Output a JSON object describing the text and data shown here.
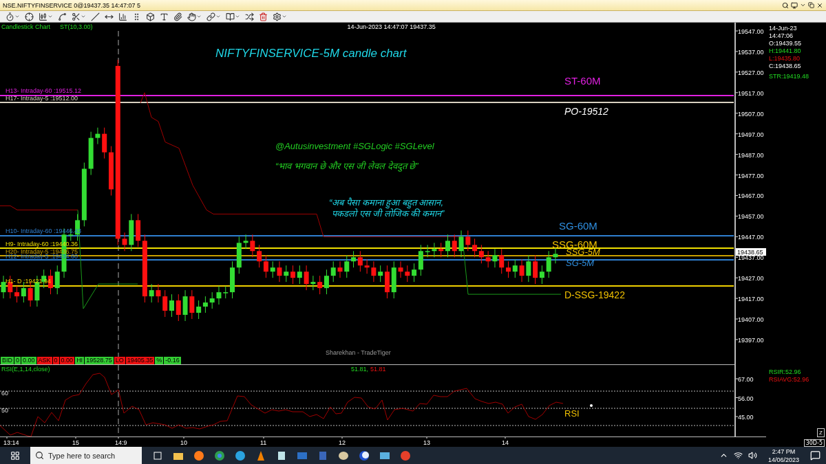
{
  "window": {
    "title": "NSE.NIFTYFINSERVICE 0@19437.35 14:47:07 5"
  },
  "chart_header": {
    "chart_type": "Candlestick Chart",
    "indicator": "ST(10,3.00)",
    "timestamp": "14-Jun-2023 14:47:07 19437.35"
  },
  "chart_title": "NIFTYFINSERVICE-5M candle chart",
  "notes": [
    {
      "text": "@Autusinvestment  #SGLogic  #SGLevel",
      "color": "#22cc22"
    },
    {
      "text": "“भाव भगवान छे और एस जी लेवल देवदुत छे”",
      "color": "#22cc22"
    },
    {
      "text": "“अब पैसा कमाना हुआ बहुत आसान,",
      "color": "#1fd6e6"
    },
    {
      "text": "पकडलो एस जी लोजिक की कमान”",
      "color": "#1fd6e6"
    }
  ],
  "levels": [
    {
      "label": "H13- Intraday-60 :19515.12",
      "color": "#e020e0"
    },
    {
      "label": "H17- Intraday-5 :19512.00",
      "color": "#d8d0c0"
    },
    {
      "label": "H10- Intraday-60 :19446.43",
      "color": "#2f7fd0"
    },
    {
      "label": "H9- Intraday-60 :19440.36",
      "color": "#f0e000"
    },
    {
      "label": "H20- Intraday-5 :19436.75",
      "color": "#c8a000"
    },
    {
      "label": "H12- Intraday-5 :19434.60",
      "color": "#2f7fd0"
    },
    {
      "label": "H1- D :19421.94",
      "color": "#f0d000"
    }
  ],
  "annotations": [
    {
      "text": "ST-60M",
      "color": "#e020e0",
      "kind": "plain"
    },
    {
      "text": "PO-19512",
      "color": "#ffffff",
      "kind": "slanted"
    },
    {
      "text": "SG-60M",
      "color": "#2f8fe0",
      "kind": "plain"
    },
    {
      "text": "SSG-60M",
      "color": "#f0c000",
      "kind": "plain"
    },
    {
      "text": "SSG-5M",
      "color": "#f0c000",
      "kind": "slanted"
    },
    {
      "text": "SG-5M",
      "color": "#2f8fe0",
      "kind": "slanted"
    },
    {
      "text": "D-SSG-19422",
      "color": "#f0c000",
      "kind": "plain"
    }
  ],
  "branding": "Sharekhan - TradeTiger",
  "price_axis": {
    "ticks": [
      "19547.00",
      "19537.00",
      "19527.00",
      "19517.00",
      "19507.00",
      "19497.00",
      "19487.00",
      "19477.00",
      "19467.00",
      "19457.00",
      "19447.00",
      "19437.00",
      "19427.00",
      "19417.00",
      "19407.00",
      "19397.00"
    ],
    "current_price": "19438.65"
  },
  "ohlc": {
    "date": "14-Jun-23",
    "time": "14:47:06",
    "open": "O:19439.55",
    "high": "H:19441.80",
    "low": "L:19435.80",
    "close": "C:19438.65",
    "supertrend": "STR:19419.48"
  },
  "quote_bar": [
    {
      "cells": [
        "BID",
        "0",
        "0.00"
      ],
      "color": "#33cc33"
    },
    {
      "cells": [
        "ASK",
        "0",
        "0.00"
      ],
      "color": "#ee1111"
    },
    {
      "cells": [
        "HI",
        "19528.75"
      ],
      "color": "#33cc33"
    },
    {
      "cells": [
        "LO",
        "19405.35"
      ],
      "color": "#ee1111"
    },
    {
      "cells": [
        "%",
        "-0.16"
      ],
      "color": "#33cc33"
    }
  ],
  "rsi": {
    "label": "RSI(E,1,14,close)",
    "value_a": "51.81,",
    "value_b": "51.81",
    "levels": [
      "60",
      "50"
    ],
    "ticks": [
      "67.00",
      "56.00",
      "45.00"
    ],
    "rsir": "RSIR:52.96",
    "rsiavg": "RSIAVG:52.96",
    "tag": "RSI"
  },
  "time_axis": [
    "13:14",
    "15",
    "14:9",
    "10",
    "11",
    "12",
    "13",
    "14"
  ],
  "zoom_button": "Z",
  "period_button": "30D-5",
  "taskbar": {
    "search": {
      "placeholder": "Type here to search"
    },
    "time": "2:47 PM",
    "date": "14/06/2023"
  }
}
